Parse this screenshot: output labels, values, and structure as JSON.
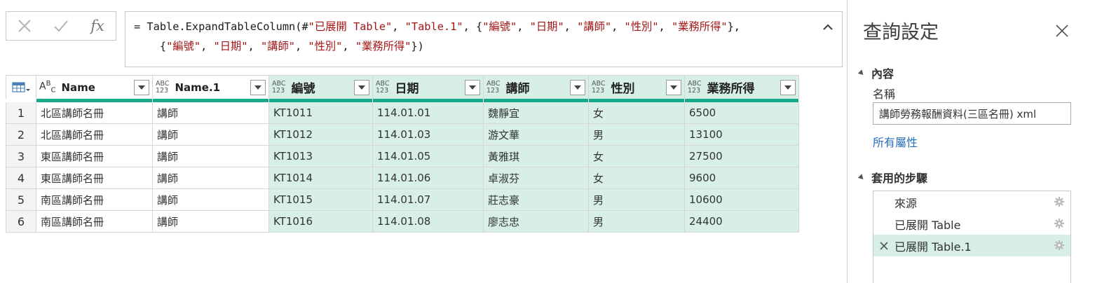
{
  "formula_bar": {
    "buttons": {
      "cancel_icon": "close-icon",
      "confirm_icon": "check-icon",
      "fx_label": "fx"
    },
    "line1": {
      "prefix": "= Table.ExpandTableColumn(#",
      "s1": "\"已展開 Table\"",
      "sep1": ", ",
      "s2": "\"Table.1\"",
      "sep2": ", {",
      "s3": "\"編號\"",
      "sep3": ", ",
      "s4": "\"日期\"",
      "sep4": ", ",
      "s5": "\"講師\"",
      "sep5": ", ",
      "s6": "\"性別\"",
      "sep6": ", ",
      "s7": "\"業務所得\"",
      "end": "},"
    },
    "line2": {
      "prefix": "    {",
      "s1": "\"編號\"",
      "sep1": ", ",
      "s2": "\"日期\"",
      "sep2": ", ",
      "s3": "\"講師\"",
      "sep3": ", ",
      "s4": "\"性別\"",
      "sep4": ", ",
      "s5": "\"業務所得\"",
      "end": "})"
    }
  },
  "grid": {
    "columns": [
      {
        "name": "Name",
        "type_top": "A",
        "type_mid": "B",
        "type_bot": "C",
        "selected": false
      },
      {
        "name": "Name.1",
        "type_top": "ABC",
        "type_bot": "123",
        "selected": false
      },
      {
        "name": "編號",
        "type_top": "ABC",
        "type_bot": "123",
        "selected": true
      },
      {
        "name": "日期",
        "type_top": "ABC",
        "type_bot": "123",
        "selected": true
      },
      {
        "name": "講師",
        "type_top": "ABC",
        "type_bot": "123",
        "selected": true
      },
      {
        "name": "性別",
        "type_top": "ABC",
        "type_bot": "123",
        "selected": true
      },
      {
        "name": "業務所得",
        "type_top": "ABC",
        "type_bot": "123",
        "selected": true
      }
    ],
    "rows": [
      [
        "1",
        "北區講師名冊",
        "講師",
        "KT1011",
        "114.01.01",
        "魏靜宜",
        "女",
        "6500"
      ],
      [
        "2",
        "北區講師名冊",
        "講師",
        "KT1012",
        "114.01.03",
        "游文華",
        "男",
        "13100"
      ],
      [
        "3",
        "東區講師名冊",
        "講師",
        "KT1013",
        "114.01.05",
        "黃雅琪",
        "女",
        "27500"
      ],
      [
        "4",
        "東區講師名冊",
        "講師",
        "KT1014",
        "114.01.06",
        "卓淑芬",
        "女",
        "9600"
      ],
      [
        "5",
        "南區講師名冊",
        "講師",
        "KT1015",
        "114.01.07",
        "莊志豪",
        "男",
        "10600"
      ],
      [
        "6",
        "南區講師名冊",
        "講師",
        "KT1016",
        "114.01.08",
        "廖志忠",
        "男",
        "24400"
      ]
    ]
  },
  "panel": {
    "title": "查詢設定",
    "properties_header": "內容",
    "name_label": "名稱",
    "name_value": "講師勞務報酬資料(三區名冊) xml",
    "all_properties": "所有屬性",
    "steps_header": "套用的步驟",
    "steps": [
      {
        "label": "來源",
        "active": false
      },
      {
        "label": "已展開 Table",
        "active": false
      },
      {
        "label": "已展開 Table.1",
        "active": true
      }
    ]
  },
  "colors": {
    "accent": "#17a98a",
    "selected_fill": "#d7efe4",
    "string_literal": "#a31515",
    "link": "#2a6ebb"
  }
}
